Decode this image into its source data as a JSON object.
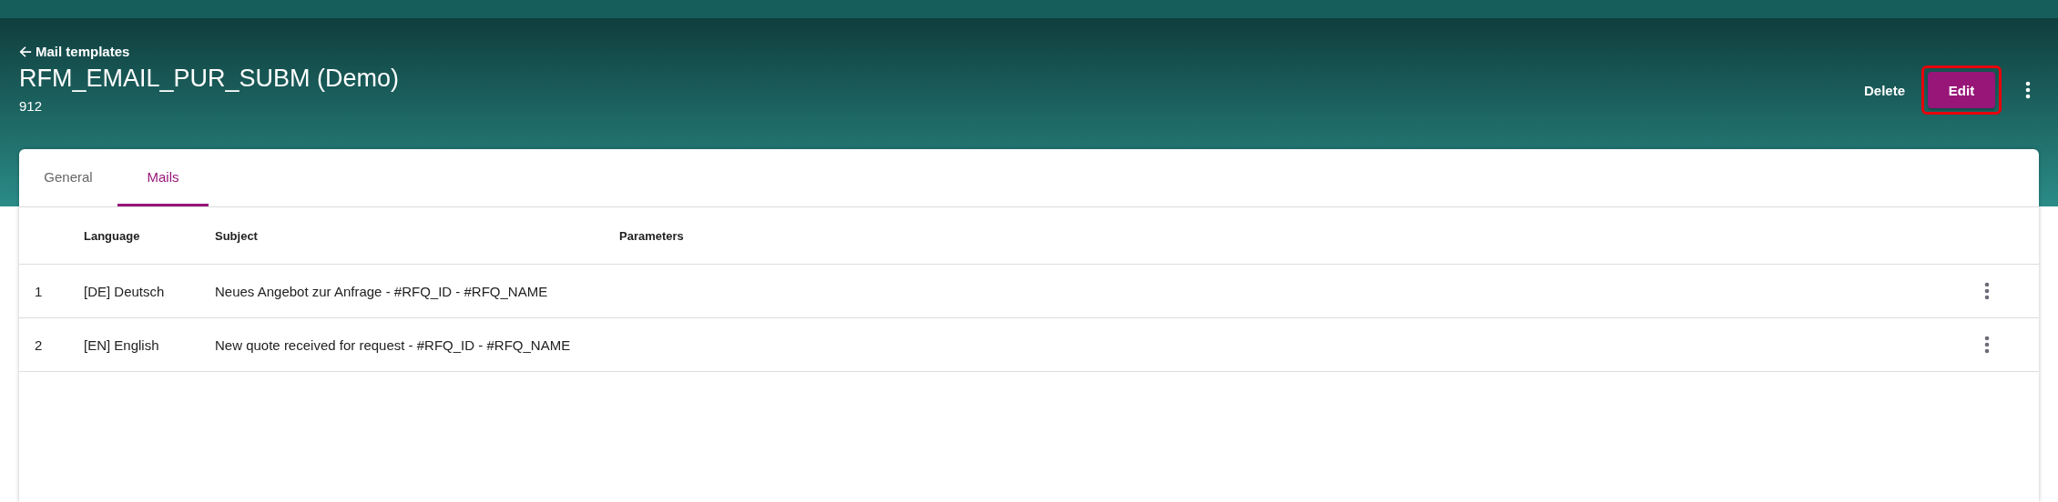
{
  "header": {
    "back_link": "Mail templates",
    "title": "RFM_EMAIL_PUR_SUBM (Demo)",
    "subtitle": "912",
    "actions": [
      {
        "label": "Delete",
        "kind": "text"
      },
      {
        "label": "Edit",
        "kind": "primary",
        "highlighted": true
      }
    ]
  },
  "tabs": [
    {
      "label": "General",
      "selected": false
    },
    {
      "label": "Mails",
      "selected": true
    }
  ],
  "table": {
    "columns": [
      "",
      "Language",
      "Subject",
      "Parameters"
    ],
    "rows": [
      {
        "cells": [
          "1",
          "[DE] Deutsch",
          "Neues Angebot zur Anfrage - #RFQ_ID - #RFQ_NAME",
          ""
        ]
      },
      {
        "cells": [
          "2",
          "[EN] English",
          "New quote received for request - #RFQ_ID - #RFQ_NAME",
          ""
        ]
      }
    ]
  }
}
